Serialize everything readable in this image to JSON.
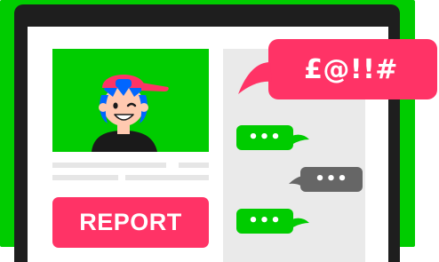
{
  "report_button": {
    "label": "REPORT"
  },
  "speech_bubble": {
    "text": "£@!!#"
  },
  "chat": {
    "messages": [
      {
        "text": "•••",
        "color": "#00cc00",
        "side": "left"
      },
      {
        "text": "•••",
        "color": "#666666",
        "side": "right"
      },
      {
        "text": "•••",
        "color": "#00cc00",
        "side": "left"
      }
    ]
  },
  "colors": {
    "brand_green": "#00cc00",
    "alert_pink": "#ff3366",
    "frame_dark": "#1e1e1e",
    "panel_grey": "#eaeaea",
    "message_grey": "#666666"
  },
  "icons": {
    "avatar": "cartoon-kid-with-cap-icon"
  }
}
